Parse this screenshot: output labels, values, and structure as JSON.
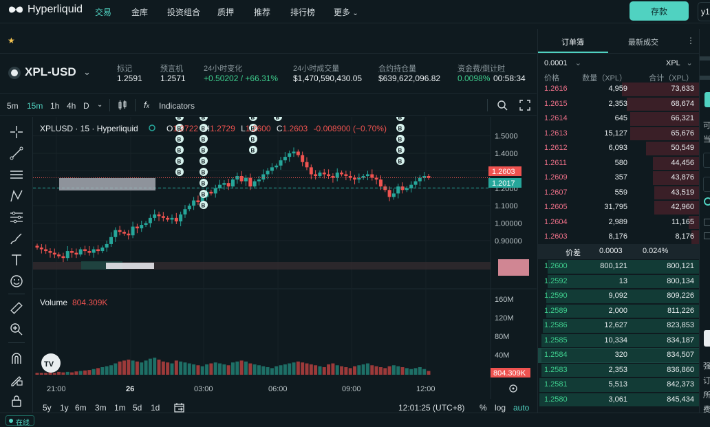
{
  "nav": {
    "brand": "Hyperliquid",
    "items": [
      {
        "label": "交易",
        "active": true
      },
      {
        "label": "金库",
        "active": false
      },
      {
        "label": "投资组合",
        "active": false
      },
      {
        "label": "质押",
        "active": false
      },
      {
        "label": "推荐",
        "active": false
      },
      {
        "label": "排行榜",
        "active": false
      },
      {
        "label": "更多",
        "active": false
      }
    ],
    "deposit_label": "存款",
    "user_partial": "y1"
  },
  "market": {
    "symbol": "XPL-USD",
    "stats": [
      {
        "label": "标记",
        "value": "1.2591",
        "color": "#e9eef0"
      },
      {
        "label": "预言机",
        "value": "1.2571",
        "color": "#e9eef0"
      },
      {
        "label": "24小时变化",
        "value": "+0.50202 / +66.31%",
        "color": "#3ecf8e"
      },
      {
        "label": "24小时成交量",
        "value": "$1,470,590,430.05",
        "color": "#e9eef0"
      },
      {
        "label": "合约持仓量",
        "value": "$639,622,096.82",
        "color": "#e9eef0"
      },
      {
        "label": "资金费/倒计时",
        "value": "0.0098%",
        "color": "#3ecf8e"
      }
    ],
    "countdown": "00:58:34"
  },
  "toolbar": {
    "intervals": [
      "5m",
      "15m",
      "1h",
      "4h",
      "D"
    ],
    "active_interval": "15m",
    "indicators_label": "Indicators"
  },
  "chart_data": {
    "type": "candlestick",
    "title": "XPLUSD · 15 · Hyperliquid",
    "ohlc_label": {
      "o": "O",
      "o_val": "1.2722",
      "h": "H",
      "h_val": "1.2729",
      "l": "L",
      "l_val": "1.2600",
      "c": "C",
      "c_val": "1.2603",
      "change": "-0.008900 (−0.70%)"
    },
    "price_ticks": [
      "1.5000",
      "1.4000",
      "1.3000",
      "1.2000",
      "1.1000",
      "1.00000",
      "0.90000"
    ],
    "ylim": [
      0.86,
      1.55
    ],
    "last_price": "1.2603",
    "mark_price": "1.2017",
    "x_ticks": [
      "21:00",
      "26",
      "03:00",
      "06:00",
      "09:00",
      "12:00"
    ],
    "candles_close": [
      0.86,
      0.85,
      0.84,
      0.83,
      0.82,
      0.81,
      0.8,
      0.84,
      0.83,
      0.82,
      0.85,
      0.84,
      0.83,
      0.85,
      0.84,
      0.86,
      0.88,
      0.92,
      0.96,
      0.95,
      0.94,
      0.93,
      0.98,
      0.97,
      0.99,
      1.0,
      1.03,
      1.05,
      1.04,
      1.03,
      1.02,
      1.03,
      1.01,
      1.05,
      1.08,
      1.1,
      1.13,
      1.12,
      1.15,
      1.18,
      1.17,
      1.2,
      1.22,
      1.23,
      1.21,
      1.25,
      1.27,
      1.24,
      1.26,
      1.21,
      1.24,
      1.25,
      1.28,
      1.3,
      1.32,
      1.33,
      1.36,
      1.38,
      1.4,
      1.41,
      1.39,
      1.35,
      1.32,
      1.28,
      1.27,
      1.29,
      1.28,
      1.27,
      1.26,
      1.29,
      1.28,
      1.27,
      1.26,
      1.25,
      1.26,
      1.27,
      1.28,
      1.26,
      1.25,
      1.21,
      1.19,
      1.15,
      1.17,
      1.21,
      1.19,
      1.2,
      1.22,
      1.24,
      1.26,
      1.27,
      1.26
    ],
    "volume": {
      "label": "Volume",
      "value": "804.309K",
      "ticks": [
        "160M",
        "120M",
        "80M",
        "40M"
      ],
      "last_label": "804.309K",
      "values_m": [
        4,
        4,
        4,
        5,
        4,
        6,
        5,
        6,
        5,
        7,
        8,
        9,
        10,
        12,
        14,
        16,
        18,
        20,
        24,
        28,
        30,
        32,
        30,
        28,
        26,
        30,
        34,
        36,
        32,
        28,
        26,
        24,
        30,
        28,
        26,
        24,
        22,
        20,
        18,
        22,
        24,
        26,
        24,
        22,
        20,
        26,
        28,
        30,
        28,
        24,
        22,
        20,
        18,
        16,
        14,
        18,
        20,
        22,
        24,
        26,
        28,
        26,
        24,
        22,
        20,
        18,
        16,
        22,
        24,
        20,
        18,
        16,
        14,
        18,
        20,
        22,
        24,
        20,
        18,
        16,
        14,
        18,
        20,
        18,
        16,
        14,
        12,
        14,
        16,
        12,
        8
      ]
    },
    "buy_marker": "B",
    "x_axis_bottom": {
      "ranges": [
        "5y",
        "1y",
        "6m",
        "3m",
        "1m",
        "5d",
        "1d"
      ],
      "time": "12:01:25 (UTC+8)",
      "pct": "%",
      "log": "log",
      "auto": "auto"
    }
  },
  "orderbook": {
    "tabs": [
      "订单簿",
      "最新成交"
    ],
    "tick_size": "0.0001",
    "unit": "XPL",
    "headers": [
      "价格",
      "数量（XPL）",
      "合计（XPL）"
    ],
    "asks": [
      {
        "price": "1.2616",
        "size": "4,959",
        "total": "73,633",
        "depth": 0.48
      },
      {
        "price": "1.2615",
        "size": "2,353",
        "total": "68,674",
        "depth": 0.45
      },
      {
        "price": "1.2614",
        "size": "645",
        "total": "66,321",
        "depth": 0.43
      },
      {
        "price": "1.2613",
        "size": "15,127",
        "total": "65,676",
        "depth": 0.43
      },
      {
        "price": "1.2612",
        "size": "6,093",
        "total": "50,549",
        "depth": 0.33
      },
      {
        "price": "1.2611",
        "size": "580",
        "total": "44,456",
        "depth": 0.29
      },
      {
        "price": "1.2609",
        "size": "357",
        "total": "43,876",
        "depth": 0.29
      },
      {
        "price": "1.2607",
        "size": "559",
        "total": "43,519",
        "depth": 0.28
      },
      {
        "price": "1.2605",
        "size": "31,795",
        "total": "42,960",
        "depth": 0.28
      },
      {
        "price": "1.2604",
        "size": "2,989",
        "total": "11,165",
        "depth": 0.07
      },
      {
        "price": "1.2603",
        "size": "8,176",
        "total": "8,176",
        "depth": 0.05
      }
    ],
    "spread": {
      "label": "价差",
      "value": "0.0003",
      "pct": "0.024%"
    },
    "bids": [
      {
        "price": "1.2600",
        "size": "800,121",
        "total": "800,121",
        "depth": 0.94
      },
      {
        "price": "1.2592",
        "size": "13",
        "total": "800,134",
        "depth": 0.94
      },
      {
        "price": "1.2590",
        "size": "9,092",
        "total": "809,226",
        "depth": 0.95
      },
      {
        "price": "1.2589",
        "size": "2,000",
        "total": "811,226",
        "depth": 0.95
      },
      {
        "price": "1.2586",
        "size": "12,627",
        "total": "823,853",
        "depth": 0.97
      },
      {
        "price": "1.2585",
        "size": "10,334",
        "total": "834,187",
        "depth": 0.98
      },
      {
        "price": "1.2584",
        "size": "320",
        "total": "834,507",
        "depth": 0.98
      },
      {
        "price": "1.2583",
        "size": "2,353",
        "total": "836,860",
        "depth": 0.98
      },
      {
        "price": "1.2581",
        "size": "5,513",
        "total": "842,373",
        "depth": 0.99
      },
      {
        "price": "1.2580",
        "size": "3,061",
        "total": "845,434",
        "depth": 0.99
      }
    ]
  },
  "right_panel_partial": [
    "可",
    "当",
    "强",
    "订",
    "所",
    "费"
  ],
  "status": {
    "online": "在线"
  },
  "colors": {
    "accent": "#50d2c1",
    "up": "#26a69a",
    "down": "#ef5350",
    "bg": "#0f1a1f",
    "ask_text": "#ed7088",
    "bid_text": "#3ecf8e"
  }
}
